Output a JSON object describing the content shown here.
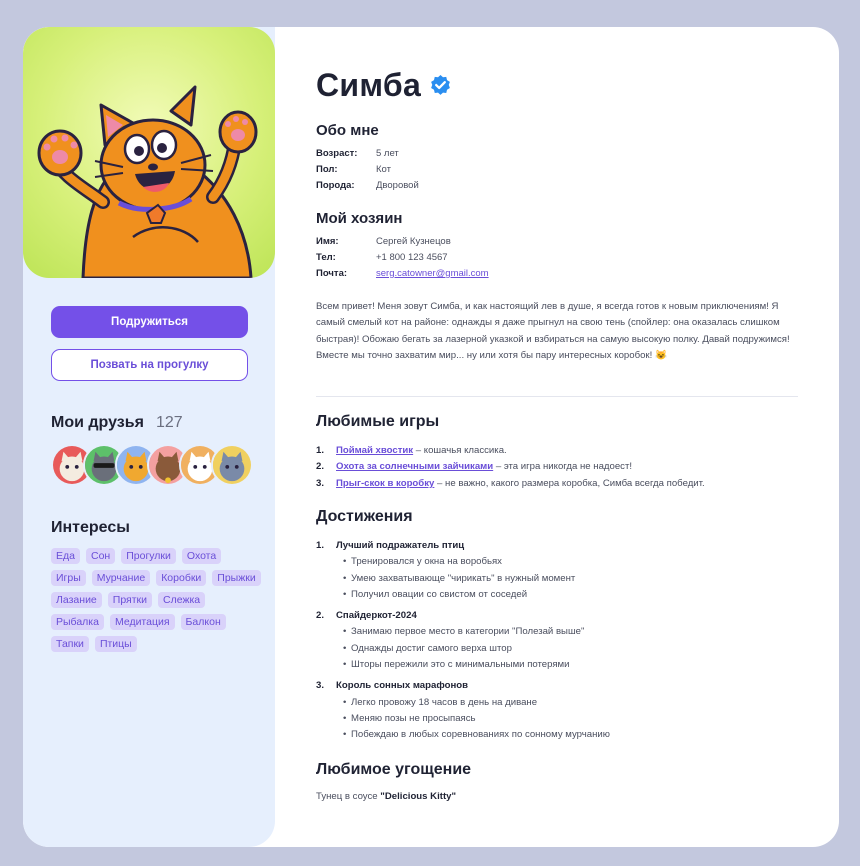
{
  "profile": {
    "name": "Симба",
    "verified_icon": "verified-badge-icon",
    "accent_color": "#7450e8"
  },
  "sidebar": {
    "primary_button": "Подружиться",
    "secondary_button": "Позвать на прогулку",
    "friends_title": "Мои друзья",
    "friends_count": "127",
    "interests_title": "Интересы",
    "interests": [
      "Еда",
      "Сон",
      "Прогулки",
      "Охота",
      "Игры",
      "Мурчание",
      "Коробки",
      "Прыжки",
      "Лазание",
      "Прятки",
      "Слежка",
      "Рыбалка",
      "Медитация",
      "Балкон",
      "Тапки",
      "Птицы"
    ]
  },
  "about": {
    "title": "Обо мне",
    "rows": [
      {
        "label": "Возраст:",
        "value": "5 лет"
      },
      {
        "label": "Пол:",
        "value": "Кот"
      },
      {
        "label": "Порода:",
        "value": "Дворовой"
      }
    ]
  },
  "owner": {
    "title": "Мой хозяин",
    "rows": [
      {
        "label": "Имя:",
        "value": "Сергей Кузнецов"
      },
      {
        "label": "Тел:",
        "value": "+1 800 123 4567"
      },
      {
        "label": "Почта:",
        "value": "serg.catowner@gmail.com"
      }
    ]
  },
  "bio": "Всем привет! Меня зовут Симба, и как настоящий лев в душе, я всегда готов к новым приключениям! Я самый смелый кот на районе: однажды я даже прыгнул на свою тень (спойлер: она оказалась слишком быстрая)! Обожаю бегать за лазерной указкой и взбираться на самую высокую полку. Давай подружимся! Вместе мы точно захватим мир... ну или хотя бы пару интересных коробок! 😺",
  "games": {
    "title": "Любимые игры",
    "items": [
      {
        "num": "1.",
        "link": "Поймай хвостик",
        "text": " – кошачья классика."
      },
      {
        "num": "2.",
        "link": "Охота за солнечными зайчиками",
        "text": " – эта игра никогда не надоест!"
      },
      {
        "num": "3.",
        "link": "Прыг-скок в коробку",
        "text": " – не важно, какого размера коробка, Симба всегда победит."
      }
    ]
  },
  "achievements": {
    "title": "Достижения",
    "groups": [
      {
        "num": "1.",
        "title": "Лучший подражатель птиц",
        "items": [
          "Тренировался у окна на воробьях",
          "Умею захватывающе \"чирикать\" в нужный момент",
          "Получил овации со свистом от соседей"
        ]
      },
      {
        "num": "2.",
        "title": "Спайдеркот-2024",
        "items": [
          "Занимаю первое место в категории \"Полезай выше\"",
          "Однажды достиг самого верха штор",
          "Шторы пережили это с минимальными потерями"
        ]
      },
      {
        "num": "3.",
        "title": "Король сонных марафонов",
        "items": [
          "Легко провожу 18 часов в день на диване",
          "Меняю позы не просыпаясь",
          "Побеждаю в любых соревнованиях по сонному мурчанию"
        ]
      }
    ]
  },
  "treat": {
    "title": "Любимое угощение",
    "prefix": "Тунец в соусе ",
    "name": "\"Delicious Kitty\""
  }
}
